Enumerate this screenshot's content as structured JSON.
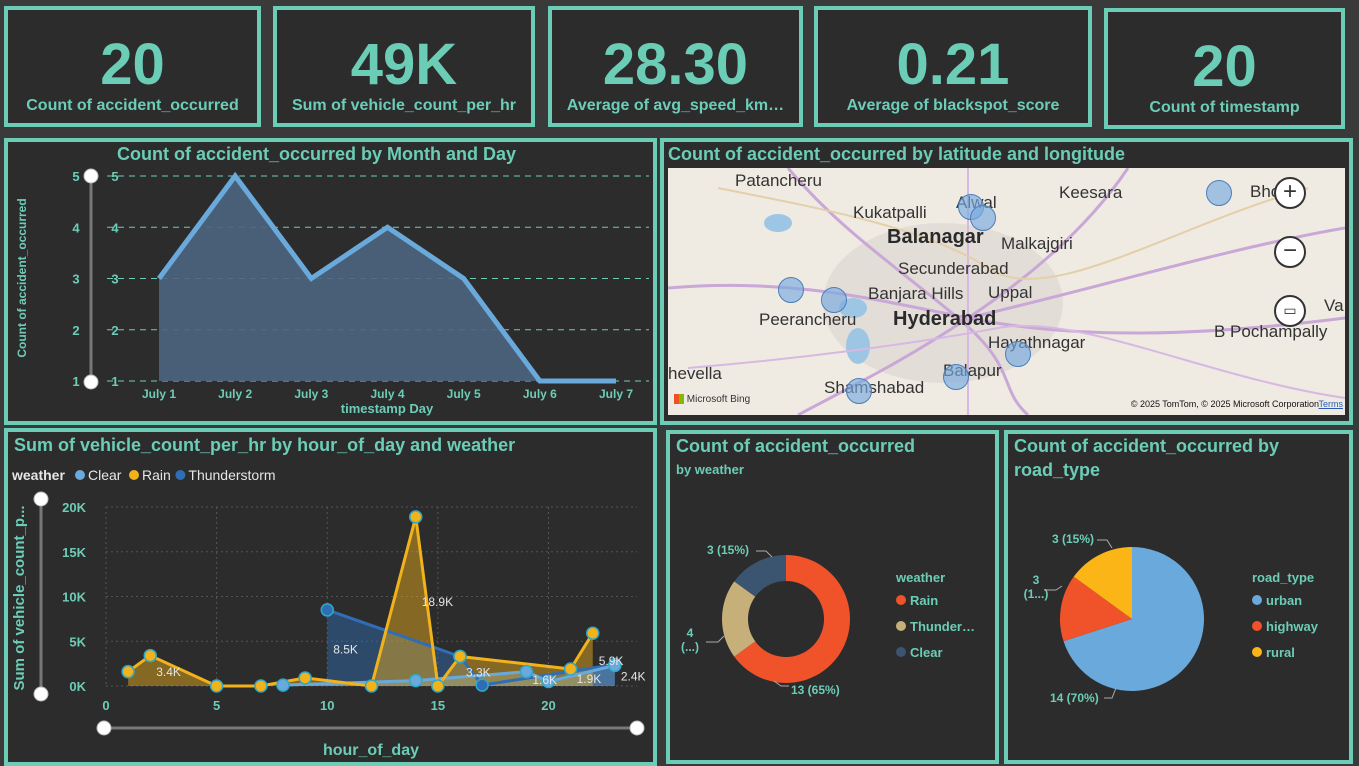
{
  "kpis": [
    {
      "value": "20",
      "label": "Count of accident_occurred"
    },
    {
      "value": "49K",
      "label": "Sum of vehicle_count_per_hr"
    },
    {
      "value": "28.30",
      "label": "Average of avg_speed_km…"
    },
    {
      "value": "0.21",
      "label": "Average of blackspot_score"
    },
    {
      "value": "20",
      "label": "Count of timestamp"
    }
  ],
  "area_chart": {
    "title": "Count of accident_occurred by Month and Day"
  },
  "map": {
    "title": "Count of accident_occurred by latitude and longitude",
    "places": [
      "Patancheru",
      "Kukatpalli",
      "Alwal",
      "Keesara",
      "Bhon",
      "Balanagar",
      "Malkajgiri",
      "Secunderabad",
      "Banjara Hills",
      "Uppal",
      "Peerancheru",
      "Hyderabad",
      "B Pochampally",
      "Va",
      "Hayathnagar",
      "hevella",
      "Balapur",
      "Shamshabad"
    ],
    "bing_label": "Microsoft Bing",
    "copyright": "© 2025 TomTom, © 2025 Microsoft Corporation",
    "terms": "Terms",
    "zoom_in": "+",
    "zoom_out": "−",
    "select_icon": "select-icon"
  },
  "line_chart": {
    "title": "Sum of vehicle_count_per_hr by hour_of_day and weather"
  },
  "donut": {
    "title": "Count of accident_occurred",
    "subtitle": "by weather"
  },
  "pie": {
    "title_line1": "Count of accident_occurred by",
    "title_line2": "road_type"
  },
  "chart_data": [
    {
      "type": "area",
      "title": "Count of accident_occurred by Month and Day",
      "xlabel": "timestamp Day",
      "ylabel": "Count of accident_occurred",
      "categories": [
        "July 1",
        "July 2",
        "July 3",
        "July 4",
        "July 5",
        "July 6",
        "July 7"
      ],
      "values": [
        3,
        5,
        3,
        4,
        3,
        1,
        1
      ],
      "ylim": [
        1,
        5
      ],
      "yticks": [
        1,
        2,
        3,
        4,
        5
      ],
      "grid": true,
      "colors": {
        "line": "#6aa9dc",
        "fill": "#4b6580"
      }
    },
    {
      "type": "line",
      "title": "Sum of vehicle_count_per_hr by hour_of_day and weather",
      "xlabel": "hour_of_day",
      "ylabel": "Sum of vehicle_count_p...",
      "legend_title": "weather",
      "legend_position": "top-left",
      "xlim": [
        0,
        24
      ],
      "xticks": [
        0,
        5,
        10,
        15,
        20
      ],
      "ylim": [
        0,
        20000
      ],
      "yticks": [
        0,
        5000,
        10000,
        15000,
        20000
      ],
      "ytick_labels": [
        "0K",
        "5K",
        "10K",
        "15K",
        "20K"
      ],
      "series": [
        {
          "name": "Clear",
          "color": "#6aa9dc",
          "x": [
            8,
            14,
            19,
            20,
            23
          ],
          "y": [
            100,
            600,
            1600,
            500,
            2300
          ]
        },
        {
          "name": "Rain",
          "color": "#f2b21b",
          "x": [
            1,
            2,
            5,
            7,
            9,
            12,
            14,
            15,
            16,
            21,
            22
          ],
          "y": [
            1600,
            3400,
            0,
            0,
            900,
            0,
            18900,
            0,
            3300,
            1900,
            5900
          ]
        },
        {
          "name": "Thunderstorm",
          "color": "#2f6eb5",
          "x": [
            10,
            16,
            17,
            23
          ],
          "y": [
            8500,
            3300,
            100,
            2400
          ]
        }
      ],
      "data_labels": [
        {
          "text": "3.4K",
          "x": 2,
          "y": 1700
        },
        {
          "text": "8.5K",
          "x": 10,
          "y": 4200
        },
        {
          "text": "18.9K",
          "x": 14,
          "y": 9500
        },
        {
          "text": "3.3K",
          "x": 16,
          "y": 1600
        },
        {
          "text": "1.6K",
          "x": 19,
          "y": 800
        },
        {
          "text": "1.9K",
          "x": 21,
          "y": 900
        },
        {
          "text": "5.9K",
          "x": 22,
          "y": 2900
        },
        {
          "text": "2.4K",
          "x": 23,
          "y": 1200
        }
      ]
    },
    {
      "type": "pie",
      "subtype": "donut",
      "title": "Count of accident_occurred",
      "subtitle": "by weather",
      "legend_title": "weather",
      "legend_position": "right",
      "slices": [
        {
          "name": "Rain",
          "value": 13,
          "label": "13 (65%)",
          "color": "#f0522a"
        },
        {
          "name": "Thunderstorm",
          "legend": "Thunder…",
          "value": 4,
          "label": "4 (...)",
          "color": "#c7af7a"
        },
        {
          "name": "Clear",
          "value": 3,
          "label": "3 (15%)",
          "color": "#3b5470"
        }
      ]
    },
    {
      "type": "pie",
      "title": "Count of accident_occurred by road_type",
      "legend_title": "road_type",
      "legend_position": "right",
      "slices": [
        {
          "name": "urban",
          "value": 14,
          "label": "14 (70%)",
          "color": "#6aa9dc"
        },
        {
          "name": "highway",
          "value": 3,
          "label": "3 (1...)",
          "color": "#f0522a"
        },
        {
          "name": "rural",
          "value": 3,
          "label": "3 (15%)",
          "color": "#fbb516"
        }
      ]
    }
  ]
}
